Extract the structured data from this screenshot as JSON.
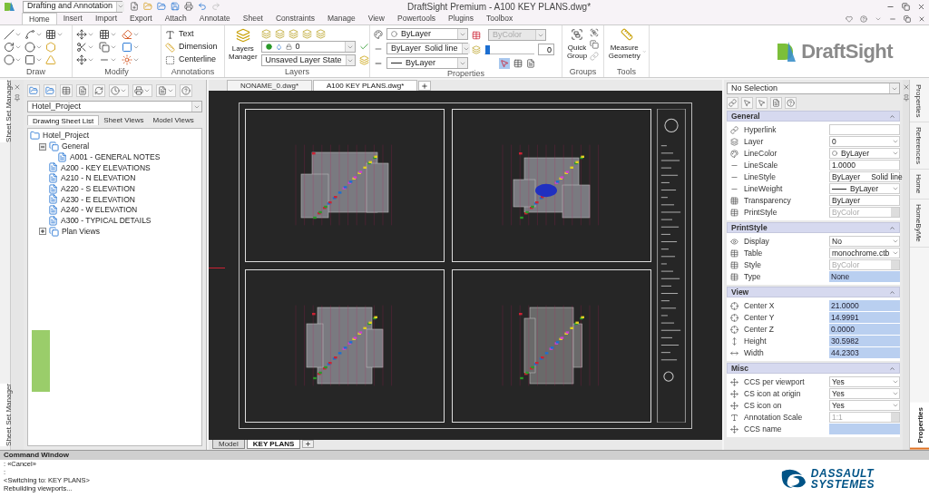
{
  "window": {
    "title": "DraftSight Premium - A100 KEY PLANS.dwg*",
    "workspace": "Drafting and Annotation"
  },
  "ribbon_tabs": [
    {
      "label": "Home",
      "selected": true
    },
    {
      "label": "Insert",
      "selected": false
    },
    {
      "label": "Import",
      "selected": false
    },
    {
      "label": "Export",
      "selected": false
    },
    {
      "label": "Attach",
      "selected": false
    },
    {
      "label": "Annotate",
      "selected": false
    },
    {
      "label": "Sheet",
      "selected": false
    },
    {
      "label": "Constraints",
      "selected": false
    },
    {
      "label": "Manage",
      "selected": false
    },
    {
      "label": "View",
      "selected": false
    },
    {
      "label": "Powertools",
      "selected": false
    },
    {
      "label": "Plugins",
      "selected": false
    },
    {
      "label": "Toolbox",
      "selected": false
    }
  ],
  "ribbon": {
    "draw": {
      "label": "Draw"
    },
    "modify": {
      "label": "Modify"
    },
    "annotations": {
      "label": "Annotations",
      "buttons": [
        "Text",
        "Dimension",
        "Centerline"
      ]
    },
    "layers": {
      "label": "Layers",
      "manager": "Layers Manager",
      "layer": "0",
      "state": "Unsaved Layer State"
    },
    "properties": {
      "label": "Properties",
      "line_color": "ByLayer",
      "linestyle": "ByLayer",
      "linestyle_name": "Solid line",
      "lineweight": "ByLayer",
      "printstyle": "ByColor",
      "transparency": "0",
      "transparency_slider": {
        "level": 0.02
      }
    },
    "groups": {
      "label": "Groups",
      "button": "Quick Group"
    },
    "tools": {
      "label": "Tools",
      "button": "Measure Geometry"
    },
    "brand": "DraftSight"
  },
  "sheet_set_manager": {
    "side_tab": "Sheet Set Manager",
    "bottom_side_tab": "Sheet Set Manager",
    "project": "Hotel_Project",
    "tabs": [
      {
        "label": "Drawing Sheet List",
        "selected": true
      },
      {
        "label": "Sheet Views",
        "selected": false
      },
      {
        "label": "Model Views",
        "selected": false
      }
    ],
    "tree": [
      {
        "label": "Hotel_Project",
        "kind": "project",
        "children": [
          {
            "label": "General",
            "kind": "subset",
            "expanded": true,
            "children": [
              {
                "label": "A001 - GENERAL NOTES",
                "kind": "sheet"
              }
            ]
          },
          {
            "label": "A200 - KEY ELEVATIONS",
            "kind": "sheet"
          },
          {
            "label": "A210 - N ELEVATION",
            "kind": "sheet"
          },
          {
            "label": "A220 - S ELEVATION",
            "kind": "sheet"
          },
          {
            "label": "A230 - E ELEVATION",
            "kind": "sheet"
          },
          {
            "label": "A240 - W ELEVATION",
            "kind": "sheet"
          },
          {
            "label": "A300 - TYPICAL DETAILS",
            "kind": "sheet"
          },
          {
            "label": "Plan Views",
            "kind": "subset",
            "expanded": false
          }
        ]
      }
    ]
  },
  "document_tabs": [
    {
      "label": "NONAME_0.dwg*",
      "selected": false
    },
    {
      "label": "A100 KEY PLANS.dwg*",
      "selected": true
    }
  ],
  "layout_tabs": [
    {
      "label": "Model",
      "selected": false
    },
    {
      "label": "KEY PLANS",
      "selected": true
    }
  ],
  "properties": {
    "selection": "No Selection",
    "sections": [
      {
        "title": "General",
        "expanded": true,
        "rows": [
          {
            "label": "Hyperlink",
            "kind": "input"
          },
          {
            "label": "Layer",
            "value": "0",
            "kind": "select"
          },
          {
            "label": "LineColor",
            "value": "ByLayer",
            "kind": "color-select"
          },
          {
            "label": "LineScale",
            "value": "1.0000",
            "kind": "input"
          },
          {
            "label": "LineStyle",
            "value": "ByLayer",
            "value2": "Solid line",
            "kind": "select"
          },
          {
            "label": "LineWeight",
            "value": "ByLayer",
            "kind": "weight-select"
          },
          {
            "label": "Transparency",
            "value": "ByLayer",
            "kind": "input"
          },
          {
            "label": "PrintStyle",
            "value": "ByColor",
            "kind": "disabled"
          }
        ]
      },
      {
        "title": "PrintStyle",
        "expanded": true,
        "rows": [
          {
            "label": "Display",
            "value": "No",
            "kind": "select"
          },
          {
            "label": "Table",
            "value": "monochrome.ctb",
            "kind": "select"
          },
          {
            "label": "Style",
            "value": "ByColor",
            "kind": "disabled"
          },
          {
            "label": "Type",
            "value": "None",
            "kind": "readonly"
          }
        ]
      },
      {
        "title": "View",
        "expanded": true,
        "rows": [
          {
            "label": "Center X",
            "value": "21.0000",
            "kind": "readonly"
          },
          {
            "label": "Center Y",
            "value": "14.9991",
            "kind": "readonly"
          },
          {
            "label": "Center Z",
            "value": "0.0000",
            "kind": "readonly"
          },
          {
            "label": "Height",
            "value": "30.5982",
            "kind": "readonly"
          },
          {
            "label": "Width",
            "value": "44.2303",
            "kind": "readonly"
          }
        ]
      },
      {
        "title": "Misc",
        "expanded": true,
        "rows": [
          {
            "label": "CCS per viewport",
            "value": "Yes",
            "kind": "select"
          },
          {
            "label": "CS icon at origin",
            "value": "Yes",
            "kind": "select"
          },
          {
            "label": "CS icon on",
            "value": "Yes",
            "kind": "select"
          },
          {
            "label": "Annotation Scale",
            "value": "1:1",
            "kind": "disabled"
          },
          {
            "label": "CCS name",
            "kind": "readonly"
          }
        ]
      }
    ]
  },
  "side_tabs": [
    {
      "label": "Properties",
      "selected": false
    },
    {
      "label": "References",
      "selected": false
    },
    {
      "label": "Home",
      "selected": false
    },
    {
      "label": "HomeByMe",
      "selected": false
    }
  ],
  "bottom_side_tab": {
    "label": "Properties",
    "selected": true
  },
  "command_window": {
    "title": "Command Window",
    "lines": [
      ": «Cancel»",
      ":",
      "<Switching to: KEY PLANS>",
      "Rebuilding viewports..."
    ]
  },
  "footer_logo": [
    "DASSAULT",
    "SYSTEMES"
  ]
}
